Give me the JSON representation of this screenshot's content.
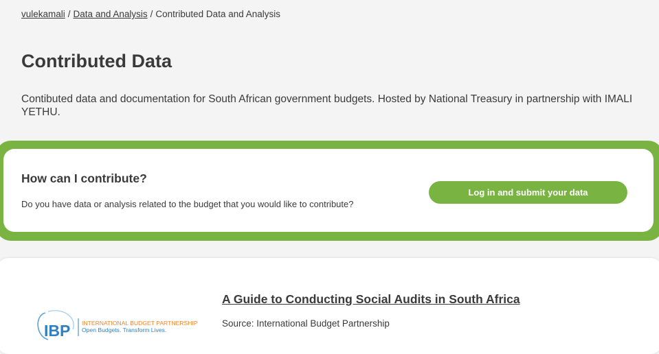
{
  "breadcrumb": {
    "items": [
      {
        "label": "vulekamali",
        "link": true
      },
      {
        "label": "Data and Analysis",
        "link": true
      },
      {
        "label": "Contributed Data and Analysis",
        "link": false
      }
    ],
    "separator": "/"
  },
  "page": {
    "title": "Contributed Data",
    "intro": "Contibuted data and documentation for South African government budgets. Hosted by National Treasury in partnership with IMALI YETHU."
  },
  "contribute": {
    "heading": "How can I contribute?",
    "text": "Do you have data or analysis related to the budget that you would like to contribute?",
    "button_label": "Log in and submit your data"
  },
  "resources": [
    {
      "title": "A Guide to Conducting Social Audits in South Africa",
      "source": "Source: International Budget Partnership",
      "logo": {
        "mark": "IBP",
        "name": "INTERNATIONAL BUDGET PARTNERSHIP",
        "tagline": "Open Budgets. Transform Lives."
      }
    }
  ],
  "colors": {
    "accent_green": "#79b443",
    "text": "#3a3a3a",
    "background": "#f4f4f4",
    "ibp_blue": "#2f7fc1",
    "ibp_orange": "#f0862b"
  }
}
